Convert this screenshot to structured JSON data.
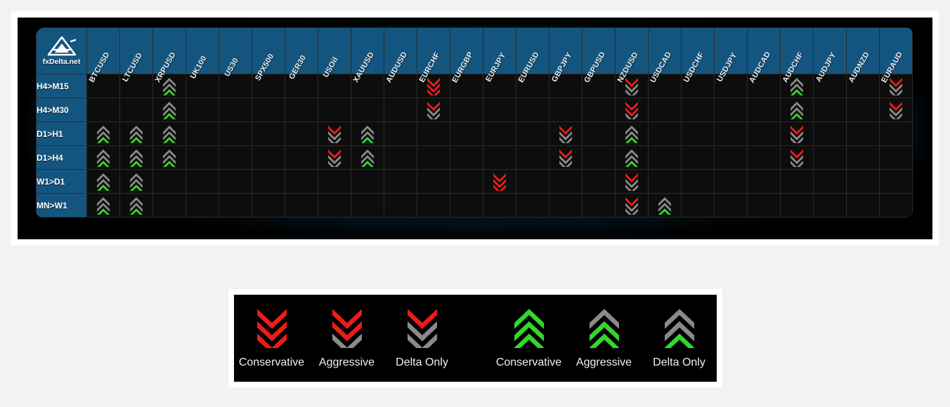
{
  "brand": {
    "name": "fxDelta.net",
    "logo_icon": "triangle-delta-logo"
  },
  "matrix": {
    "corner_label": "fxDelta.net",
    "columns": [
      "BTCUSD",
      "LTCUSD",
      "XRPUSD",
      "UK100",
      "US30",
      "SPX500",
      "GER30",
      "USOil",
      "XAUUSD",
      "AUDUSD",
      "EURCHF",
      "EURGBP",
      "EURJPY",
      "EURUSD",
      "GBPJPY",
      "GBPUSD",
      "NZDUSD",
      "USDCAD",
      "USDCHF",
      "USDJPY",
      "AUDCAD",
      "AUDCHF",
      "AUDJPY",
      "AUDNZD",
      "EURAUD"
    ],
    "rows": [
      {
        "label": "H4>M15",
        "cells": [
          "",
          "",
          "up-delta",
          "",
          "",
          "",
          "",
          "",
          "",
          "",
          "down-conservative",
          "",
          "",
          "",
          "",
          "",
          "down-delta",
          "",
          "",
          "",
          "",
          "up-delta",
          "",
          "",
          "down-delta"
        ]
      },
      {
        "label": "H4>M30",
        "cells": [
          "",
          "",
          "up-delta",
          "",
          "",
          "",
          "",
          "",
          "",
          "",
          "down-delta",
          "",
          "",
          "",
          "",
          "",
          "down-aggressive",
          "",
          "",
          "",
          "",
          "up-delta",
          "",
          "",
          "down-delta"
        ]
      },
      {
        "label": "D1>H1",
        "cells": [
          "up-delta",
          "up-delta",
          "up-delta",
          "",
          "",
          "",
          "",
          "down-delta",
          "up-delta",
          "",
          "",
          "",
          "",
          "",
          "down-delta",
          "",
          "up-delta",
          "",
          "",
          "",
          "",
          "down-delta",
          "",
          "",
          ""
        ]
      },
      {
        "label": "D1>H4",
        "cells": [
          "up-delta",
          "up-delta",
          "up-delta",
          "",
          "",
          "",
          "",
          "down-delta",
          "up-delta",
          "",
          "",
          "",
          "",
          "",
          "down-delta",
          "",
          "up-delta",
          "",
          "",
          "",
          "",
          "down-delta",
          "",
          "",
          ""
        ]
      },
      {
        "label": "W1>D1",
        "cells": [
          "up-delta",
          "up-delta",
          "",
          "",
          "",
          "",
          "",
          "",
          "",
          "",
          "",
          "",
          "down-conservative",
          "",
          "",
          "",
          "down-delta",
          "",
          "",
          "",
          "",
          "",
          "",
          "",
          ""
        ]
      },
      {
        "label": "MN>W1",
        "cells": [
          "up-delta",
          "up-delta",
          "",
          "",
          "",
          "",
          "",
          "",
          "",
          "",
          "",
          "",
          "",
          "",
          "",
          "",
          "down-delta",
          "up-delta",
          "",
          "",
          "",
          "",
          "",
          "",
          ""
        ]
      }
    ]
  },
  "legend": {
    "down_group": [
      {
        "label": "Conservative",
        "signal": "down-conservative"
      },
      {
        "label": "Aggressive",
        "signal": "down-aggressive"
      },
      {
        "label": "Delta Only",
        "signal": "down-delta"
      }
    ],
    "up_group": [
      {
        "label": "Conservative",
        "signal": "up-conservative"
      },
      {
        "label": "Aggressive",
        "signal": "up-aggressive"
      },
      {
        "label": "Delta Only",
        "signal": "up-delta"
      }
    ]
  },
  "colors": {
    "header_blue": "#14557f",
    "cell_black": "#0d0d0d",
    "grid_line": "#2a2a2a",
    "bull_green": "#35d62a",
    "bear_red": "#ee1b1b",
    "neutral_gray": "#8a8a8a",
    "page_background": "#f2f2f2",
    "frame_white": "#ffffff"
  }
}
